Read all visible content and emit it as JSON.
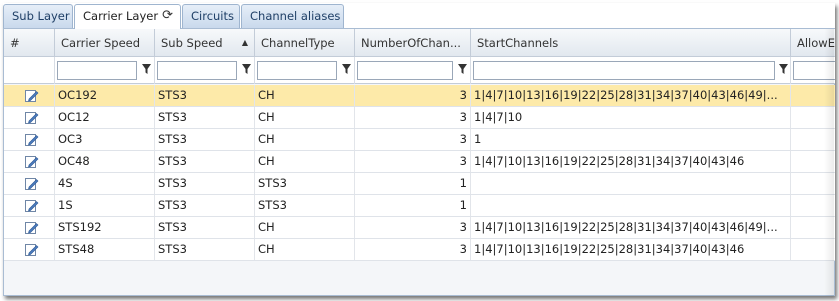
{
  "tabs": [
    {
      "label": "Sub Layer"
    },
    {
      "label": "Carrier Layer",
      "refresh_icon": "refresh-icon"
    },
    {
      "label": "Circuits"
    },
    {
      "label": "Channel aliases"
    }
  ],
  "grid": {
    "columns": [
      {
        "label": "#"
      },
      {
        "label": "Carrier Speed"
      },
      {
        "label": "Sub Speed",
        "sorted": "asc"
      },
      {
        "label": "ChannelType"
      },
      {
        "label": "NumberOfChan..."
      },
      {
        "label": "StartChannels"
      },
      {
        "label": "AllowE"
      }
    ],
    "filters": [
      "",
      "",
      "",
      "",
      ""
    ],
    "rows": [
      {
        "carrier_speed": "OC192",
        "sub_speed": "STS3",
        "channel_type": "CH",
        "number_of_channels": "3",
        "start_channels": "1|4|7|10|13|16|19|22|25|28|31|34|37|40|43|46|49|...",
        "selected": true
      },
      {
        "carrier_speed": "OC12",
        "sub_speed": "STS3",
        "channel_type": "CH",
        "number_of_channels": "3",
        "start_channels": "1|4|7|10"
      },
      {
        "carrier_speed": "OC3",
        "sub_speed": "STS3",
        "channel_type": "CH",
        "number_of_channels": "3",
        "start_channels": "1"
      },
      {
        "carrier_speed": "OC48",
        "sub_speed": "STS3",
        "channel_type": "CH",
        "number_of_channels": "3",
        "start_channels": "1|4|7|10|13|16|19|22|25|28|31|34|37|40|43|46"
      },
      {
        "carrier_speed": "4S",
        "sub_speed": "STS3",
        "channel_type": "STS3",
        "number_of_channels": "1",
        "start_channels": ""
      },
      {
        "carrier_speed": "1S",
        "sub_speed": "STS3",
        "channel_type": "STS3",
        "number_of_channels": "1",
        "start_channels": ""
      },
      {
        "carrier_speed": "STS192",
        "sub_speed": "STS3",
        "channel_type": "CH",
        "number_of_channels": "3",
        "start_channels": "1|4|7|10|13|16|19|22|25|28|31|34|37|40|43|46|49|..."
      },
      {
        "carrier_speed": "STS48",
        "sub_speed": "STS3",
        "channel_type": "CH",
        "number_of_channels": "3",
        "start_channels": "1|4|7|10|13|16|19|22|25|28|31|34|37|40|43|46"
      }
    ]
  },
  "colors": {
    "selected_row": "#fdeaa9",
    "tab_text": "#1f3f66"
  }
}
